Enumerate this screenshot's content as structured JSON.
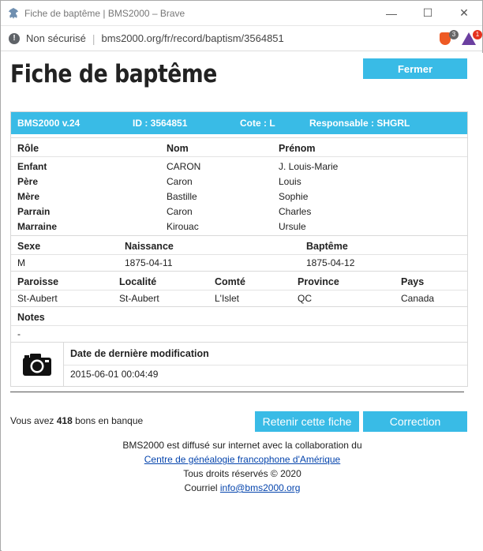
{
  "window": {
    "title": "Fiche de baptême | BMS2000 – Brave",
    "minimize": "—",
    "maximize": "☐",
    "close": "✕"
  },
  "address": {
    "secure_label": "Non sécurisé",
    "url": "bms2000.org/fr/record/baptism/3564851",
    "shield_count": "3",
    "rewards_count": "1"
  },
  "page": {
    "title": "Fiche de baptême",
    "close_button": "Fermer"
  },
  "record": {
    "header": {
      "version": "BMS2000 v.24",
      "id": "ID : 3564851",
      "cote": "Cote : L",
      "responsable": "Responsable : SHGRL"
    },
    "people": {
      "headers": [
        "Rôle",
        "Nom",
        "Prénom"
      ],
      "rows": [
        {
          "role": "Enfant",
          "nom": "CARON",
          "prenom": "J. Louis-Marie"
        },
        {
          "role": "Père",
          "nom": "Caron",
          "prenom": "Louis"
        },
        {
          "role": "Mère",
          "nom": "Bastille",
          "prenom": "Sophie"
        },
        {
          "role": "Parrain",
          "nom": "Caron",
          "prenom": "Charles"
        },
        {
          "role": "Marraine",
          "nom": "Kirouac",
          "prenom": "Ursule"
        }
      ]
    },
    "dates": {
      "headers": [
        "Sexe",
        "Naissance",
        "Baptême"
      ],
      "values": [
        "M",
        "1875-04-11",
        "1875-04-12"
      ]
    },
    "place": {
      "headers": [
        "Paroisse",
        "Localité",
        "Comté",
        "Province",
        "Pays"
      ],
      "values": [
        "St-Aubert",
        "St-Aubert",
        "L'Islet",
        "QC",
        "Canada"
      ]
    },
    "notes": {
      "header": "Notes",
      "value": "-"
    },
    "modification": {
      "header": "Date de dernière modification",
      "value": "2015-06-01 00:04:49"
    }
  },
  "bank": {
    "prefix": "Vous avez",
    "count": "418",
    "suffix": "bons en banque"
  },
  "actions": {
    "keep": "Retenir cette fiche",
    "correction": "Correction"
  },
  "footer": {
    "line1": "BMS2000 est diffusé sur internet avec la collaboration du",
    "link": "Centre de généalogie francophone d'Amérique",
    "rights": "Tous droits réservés © 2020",
    "mail_label": "Courriel",
    "mail": "info@bms2000.org"
  },
  "colors": {
    "accent": "#39bbe6"
  }
}
